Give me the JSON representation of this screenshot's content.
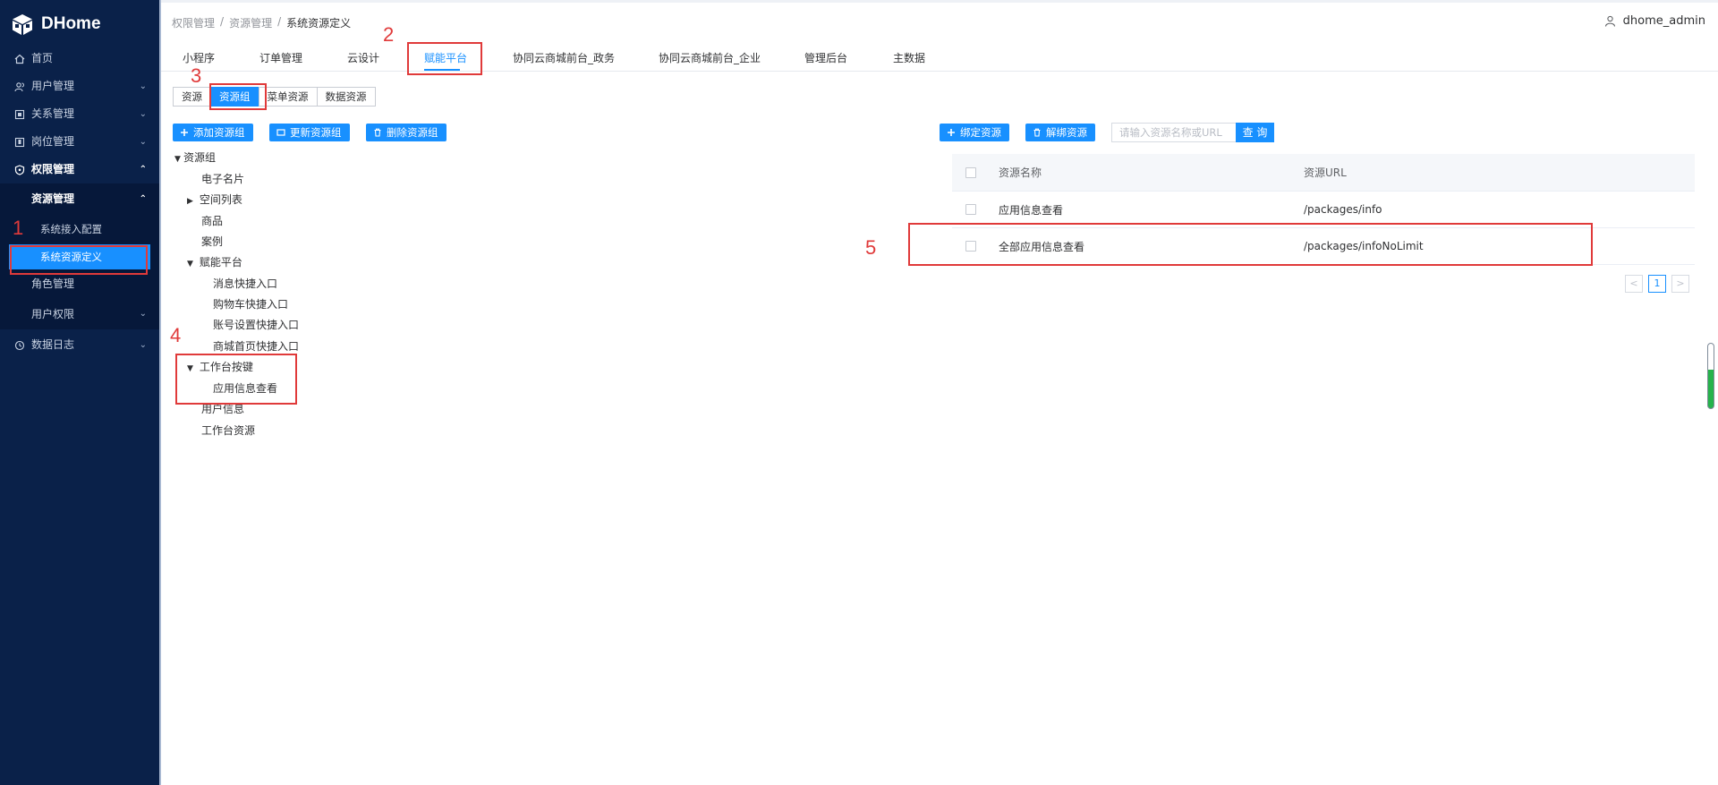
{
  "app": {
    "name": "DHome"
  },
  "sidebar": {
    "items": [
      {
        "label": "首页",
        "icon": "home-icon"
      },
      {
        "label": "用户管理",
        "icon": "users-icon"
      },
      {
        "label": "关系管理",
        "icon": "relation-icon"
      },
      {
        "label": "岗位管理",
        "icon": "post-icon"
      },
      {
        "label": "权限管理",
        "icon": "shield-icon"
      },
      {
        "label": "资源管理"
      },
      {
        "label": "系统接入配置"
      },
      {
        "label": "系统资源定义"
      },
      {
        "label": "角色管理"
      },
      {
        "label": "用户权限"
      },
      {
        "label": "数据日志",
        "icon": "log-icon"
      }
    ]
  },
  "header": {
    "breadcrumb": [
      "权限管理",
      "/",
      "资源管理",
      "/",
      "系统资源定义"
    ],
    "user": "dhome_admin"
  },
  "tabs": [
    "小程序",
    "订单管理",
    "云设计",
    "赋能平台",
    "协同云商城前台_政务",
    "协同云商城前台_企业",
    "管理后台",
    "主数据"
  ],
  "subtabs": [
    "资源",
    "资源组",
    "菜单资源",
    "数据资源"
  ],
  "left_buttons": [
    "添加资源组",
    "更新资源组",
    "删除资源组"
  ],
  "tree": [
    "资源组",
    "电子名片",
    "空间列表",
    "商品",
    "案例",
    "赋能平台",
    "消息快捷入口",
    "购物车快捷入口",
    "账号设置快捷入口",
    "商城首页快捷入口",
    "工作台按键",
    "应用信息查看",
    "用户信息",
    "工作台资源"
  ],
  "right_toolbar": {
    "bind": "绑定资源",
    "unbind": "解绑资源",
    "search_placeholder": "请输入资源名称或URL",
    "search_btn": "查 询"
  },
  "table": {
    "headers": [
      "资源名称",
      "资源URL"
    ],
    "rows": [
      [
        "应用信息查看",
        "/packages/info"
      ],
      [
        "全部应用信息查看",
        "/packages/infoNoLimit"
      ]
    ]
  },
  "pagination": {
    "prev": "<",
    "current": "1",
    "next": ">"
  },
  "annotations": [
    "1",
    "2",
    "3",
    "4",
    "5"
  ],
  "colors": {
    "sidebar_bg": "#0a2149",
    "accent": "#1890ff",
    "annotation": "#e03a3a"
  }
}
